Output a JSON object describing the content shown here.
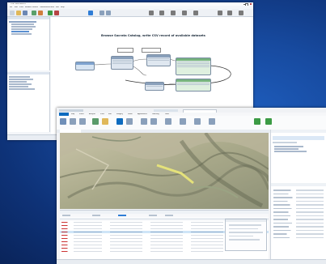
{
  "desktop": {
    "background": "#1552b0"
  },
  "workbench": {
    "title": "FME Workbench",
    "menu": [
      "File",
      "Edit",
      "View",
      "Readers",
      "Writers",
      "Transformers",
      "Tools",
      "Run",
      "Help"
    ],
    "canvas_title": "Browse Socrata Catalog, write CSV record of available datasets",
    "accent": "#2f7dd6"
  },
  "gis": {
    "tabs": [
      "Map",
      "Insert",
      "Analysis",
      "View",
      "Edit",
      "Imagery",
      "Share",
      "Appearance",
      "Labeling",
      "Data"
    ],
    "accent": "#0d6bbf"
  }
}
